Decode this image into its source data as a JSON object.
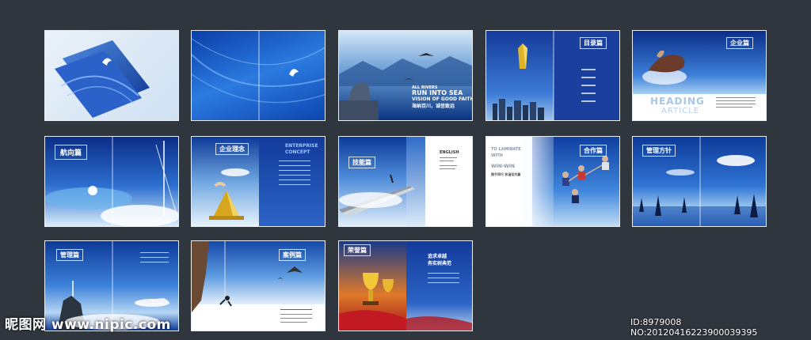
{
  "spreads": {
    "s3": {
      "title_line1": "ALL RIVERS",
      "title_line2": "RUN INTO SEA",
      "title_line3": "VISION OF GOOD FAITH",
      "cn": "海纳百川，诚信致远"
    },
    "s4": {
      "label": "目录篇"
    },
    "s5": {
      "label": "企业篇",
      "heading": "HEADING",
      "sub": "ARTICLE"
    },
    "s6": {
      "label": "航向篇"
    },
    "s7": {
      "label": "企业理念",
      "side_en1": "ENTERPRISE",
      "side_en2": "CONCEPT"
    },
    "s8": {
      "label": "技能篇",
      "en": "ENGLISH"
    },
    "s9": {
      "label": "合作篇",
      "en1": "TO LAMINATE",
      "en2": "WITH",
      "en3": "WIN-WIN",
      "cn": "携手同行 和谐促共赢"
    },
    "s10": {
      "label": "管理方针"
    },
    "s11": {
      "label": "管理篇"
    },
    "s12": {
      "label": "案例篇"
    },
    "s13": {
      "label": "荣誉篇",
      "cn1": "追求卓越",
      "cn2": "务实树典范"
    }
  },
  "watermark": {
    "site": "昵图网 www.nipic.com",
    "id": "ID:8979008 NO:20120416223900039395"
  }
}
